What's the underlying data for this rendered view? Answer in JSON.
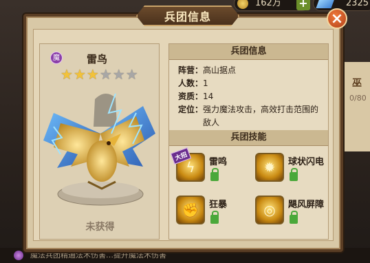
{
  "resources": {
    "gold": "162万",
    "gems": "2325"
  },
  "dialog": {
    "title": "兵团信息",
    "close_glyph": "×"
  },
  "unit": {
    "faction_badge": "魔",
    "name": "雷鸟",
    "stars_total": 6,
    "stars_filled": 3,
    "status": "未获得"
  },
  "info": {
    "header": "兵团信息",
    "lines": [
      {
        "key": "阵营：",
        "value": "高山据点"
      },
      {
        "key": "人数：",
        "value": "1"
      },
      {
        "key": "资质：",
        "value": "14"
      },
      {
        "key": "定位：",
        "value": "强力魔法攻击，高效打击范围的敌人"
      }
    ]
  },
  "skills": {
    "header": "兵团技能",
    "ult_tag": "大招",
    "items": [
      {
        "name": "雷鸣",
        "icon": "thunder-bird-icon"
      },
      {
        "name": "球状闪电",
        "icon": "ball-lightning-icon"
      },
      {
        "name": "狂暴",
        "icon": "fist-icon"
      },
      {
        "name": "飓风屏障",
        "icon": "tornado-shield-icon"
      }
    ]
  },
  "background": {
    "side_label": "巫",
    "side_count": "0/80",
    "bottom_text": "魔法兵团精通法术伤害…提升魔法术伤害"
  },
  "colors": {
    "dialog_bg": "#d8c8a6",
    "star_on": "#f2c23a",
    "star_off": "#a8a7a6",
    "magic_badge": "#8a3fa8",
    "lock_green": "#4aa83a"
  }
}
